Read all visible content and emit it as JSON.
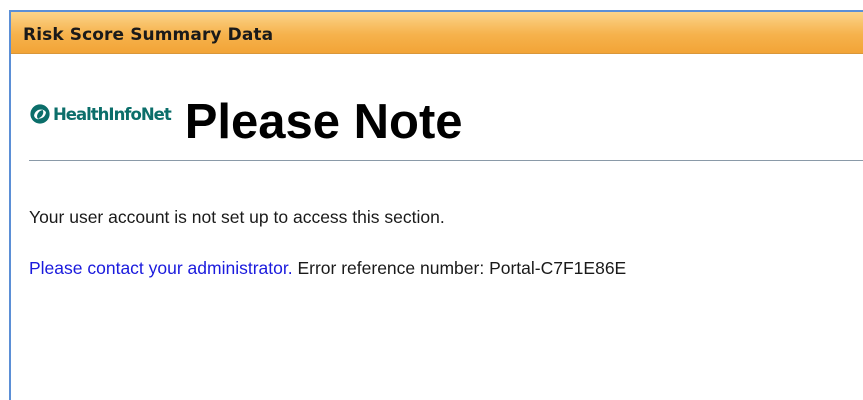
{
  "panel": {
    "title": "Risk Score Summary Data"
  },
  "brand": {
    "logo_text": "HealthInfoNet",
    "logo_icon": "healthinfonet-logo-icon"
  },
  "notice": {
    "title": "Please Note",
    "message": "Your user account is not set up to access this section.",
    "contact_link": "Please contact your administrator.",
    "error_text": " Error reference number: Portal-C7F1E86E"
  },
  "colors": {
    "header_bar": "#f6b24c",
    "frame_border": "#5b8fd6",
    "link": "#1a1add",
    "logo": "#0b6e6a"
  }
}
